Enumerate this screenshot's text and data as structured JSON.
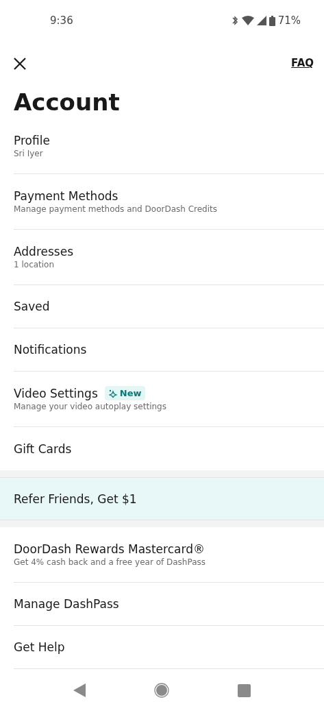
{
  "status_bar": {
    "time": "9:36",
    "battery": "71%"
  },
  "header": {
    "faq": "FAQ"
  },
  "title": "Account",
  "items": [
    {
      "kind": "item",
      "label": "Profile",
      "subtitle": "Sri Iyer"
    },
    {
      "kind": "item",
      "label": "Payment Methods",
      "subtitle": "Manage payment methods and DoorDash Credits"
    },
    {
      "kind": "item",
      "label": "Addresses",
      "subtitle": "1 location"
    },
    {
      "kind": "item",
      "label": "Saved"
    },
    {
      "kind": "item",
      "label": "Notifications"
    },
    {
      "kind": "item",
      "label": "Video Settings",
      "badge": "New",
      "subtitle": "Manage your video autoplay settings"
    },
    {
      "kind": "item",
      "label": "Gift Cards"
    },
    {
      "kind": "highlight",
      "label": "Refer Friends, Get $1"
    },
    {
      "kind": "item",
      "label": "DoorDash Rewards Mastercard®",
      "subtitle": "Get 4% cash back and a free year of DashPass"
    },
    {
      "kind": "item",
      "label": "Manage DashPass"
    },
    {
      "kind": "item",
      "label": "Get Help"
    }
  ]
}
